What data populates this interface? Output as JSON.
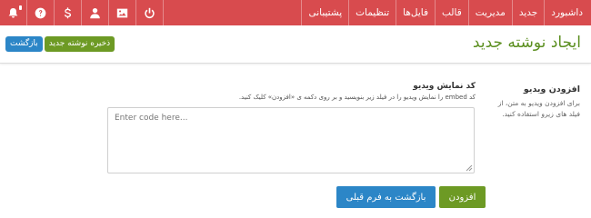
{
  "nav": {
    "items": [
      "داشبورد",
      "جدید",
      "مدیریت",
      "قالب",
      "فایل‌ها",
      "تنظیمات",
      "پشتیبانی"
    ]
  },
  "icons": [
    "bell-icon",
    "help-icon",
    "dollar-icon",
    "user-icon",
    "image-icon",
    "power-icon"
  ],
  "colors": {
    "topbar": "#d84b4e",
    "accent_green": "#6d9a24",
    "accent_blue": "#2c86c7",
    "title_green": "#5b8f1f"
  },
  "header": {
    "title": "ایجاد نوشته جدید",
    "save_label": "ذخیره نوشته جدید",
    "back_label": "بازگشت"
  },
  "sidebar": {
    "title": "افزودن ویدیو",
    "description": "برای افزودن ویدیو به متن، از فیلد های زیرو استفاده کنید."
  },
  "form": {
    "field_title": "کد نمایش ویدیو",
    "field_desc": "کد embed را نمایش ویدیو را در فیلد زیر بنویسید و بر روی دکمه ی «افزودن» کلیک کنید.",
    "placeholder": "Enter code here...",
    "add_label": "افزودن",
    "back_label": "بازگشت به فرم قبلی"
  }
}
